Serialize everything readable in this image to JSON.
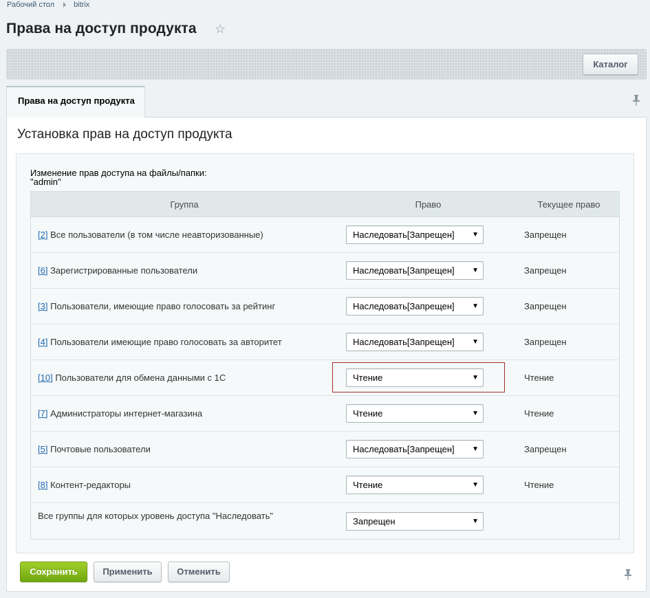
{
  "breadcrumb": {
    "items": [
      "Рабочий стол",
      "bitrix"
    ]
  },
  "page": {
    "title": "Права на доступ продукта"
  },
  "toolbar": {
    "catalog_label": "Каталог"
  },
  "tabs": [
    {
      "label": "Права на доступ продукта"
    }
  ],
  "section": {
    "title": "Установка прав на доступ продукта",
    "note_line1": "Изменение прав доступа на файлы/папки:",
    "note_line2": "\"admin\""
  },
  "table": {
    "headers": {
      "group": "Группа",
      "right": "Право",
      "current": "Текущее право"
    },
    "rows": [
      {
        "id": "[2]",
        "name": "Все пользователи (в том числе неавторизованные)",
        "right": "Наследовать[Запрещен]",
        "current": "Запрещен"
      },
      {
        "id": "[6]",
        "name": "Зарегистрированные пользователи",
        "right": "Наследовать[Запрещен]",
        "current": "Запрещен"
      },
      {
        "id": "[3]",
        "name": "Пользователи, имеющие право голосовать за рейтинг",
        "right": "Наследовать[Запрещен]",
        "current": "Запрещен"
      },
      {
        "id": "[4]",
        "name": "Пользователи имеющие право голосовать за авторитет",
        "right": "Наследовать[Запрещен]",
        "current": "Запрещен"
      },
      {
        "id": "[10]",
        "name": "Пользователи для обмена данными с 1С",
        "right": "Чтение",
        "current": "Чтение"
      },
      {
        "id": "[7]",
        "name": "Администраторы интернет-магазина",
        "right": "Чтение",
        "current": "Чтение"
      },
      {
        "id": "[5]",
        "name": "Почтовые пользователи",
        "right": "Наследовать[Запрещен]",
        "current": "Запрещен"
      },
      {
        "id": "[8]",
        "name": "Контент-редакторы",
        "right": "Чтение",
        "current": "Чтение"
      }
    ],
    "inherit_row": {
      "label": "Все группы для которых уровень доступа \"Наследовать\"",
      "right": "Запрещен"
    }
  },
  "actions": {
    "save": "Сохранить",
    "apply": "Применить",
    "cancel": "Отменить"
  },
  "colors": {
    "accent_green": "#7ab317",
    "highlight_border": "#a52a2a",
    "link": "#2067b0"
  },
  "icons": {
    "favorite": "star-icon",
    "pin": "pin-icon",
    "dropdown": "triangle-down-icon"
  }
}
